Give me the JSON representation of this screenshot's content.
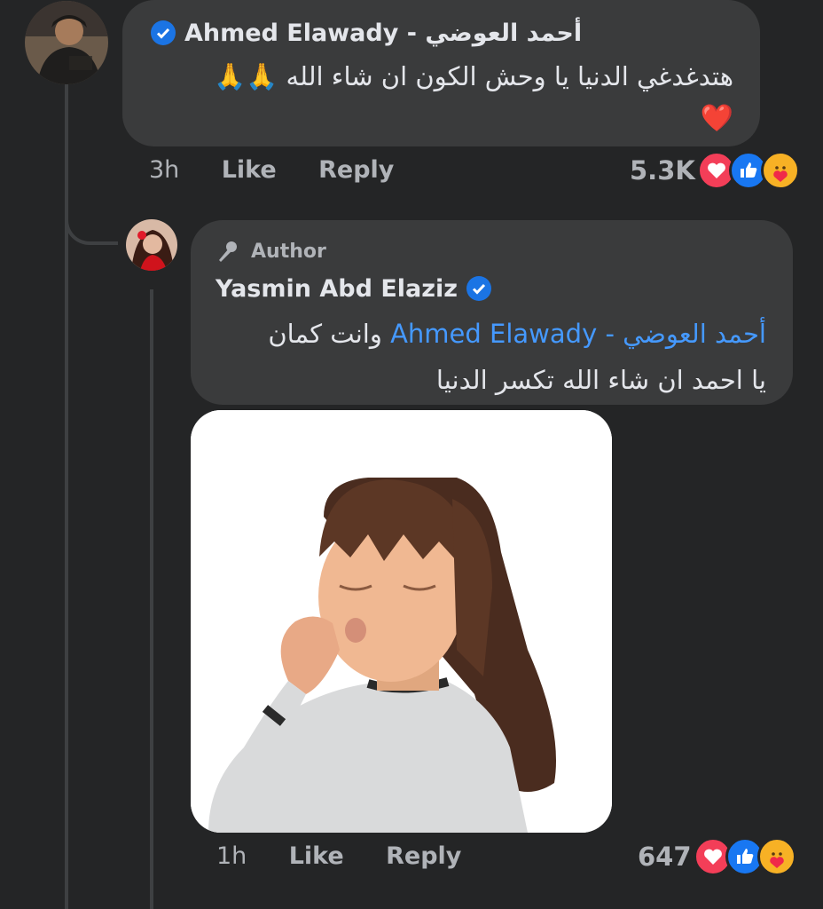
{
  "comment1": {
    "name": "Ahmed Elawady - أحمد العوضي",
    "text": "هتدغدغي الدنيا  يا وحش الكون ان شاء الله 🙏🙏",
    "heart": "❤️",
    "time": "3h",
    "like_label": "Like",
    "reply_label": "Reply",
    "reaction_count": "5.3K"
  },
  "comment2": {
    "author_badge": "Author",
    "name": "Yasmin Abd Elaziz",
    "mention": "أحمد العوضي - Ahmed Elawady",
    "text_after_mention": " وانت كمان",
    "line2": "يا احمد ان شاء الله تكسر الدنيا",
    "time": "1h",
    "like_label": "Like",
    "reply_label": "Reply",
    "reaction_count": "647"
  },
  "icons": [
    "verified-badge-icon",
    "microphone-icon",
    "love-reaction-icon",
    "like-reaction-icon",
    "care-reaction-icon"
  ],
  "colors": {
    "background": "#242526",
    "bubble": "#3a3b3c",
    "mention": "#4599ff",
    "verified": "#1b74e4",
    "love": "#f33e58",
    "like": "#1877f2",
    "care": "#f7b125"
  }
}
